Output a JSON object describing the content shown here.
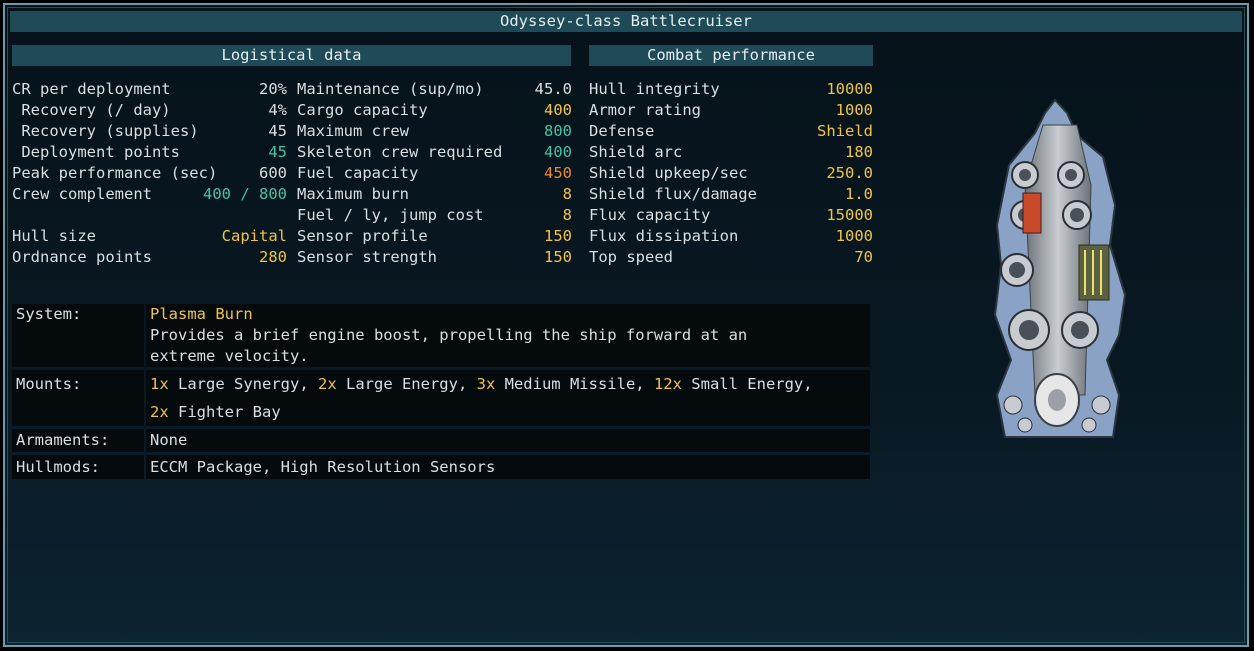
{
  "title": "Odyssey-class Battlecruiser",
  "logistical": {
    "header": "Logistical data",
    "col1": [
      {
        "label": "CR per deployment",
        "value": "20%",
        "color": "white"
      },
      {
        "label": " Recovery (/ day)",
        "value": "4%",
        "color": "white"
      },
      {
        "label": " Recovery (supplies)",
        "value": "45",
        "color": "white"
      },
      {
        "label": " Deployment points",
        "value": "45",
        "color": "teal"
      },
      {
        "label": "Peak performance (sec)",
        "value": "600",
        "color": "white"
      },
      {
        "label": "Crew complement",
        "value": "400 / 800",
        "color": "teal"
      },
      {
        "label": "",
        "value": "",
        "color": "white"
      },
      {
        "label": "Hull size",
        "value": "Capital",
        "color": "yellow"
      },
      {
        "label": "Ordnance points",
        "value": "280",
        "color": "yellow"
      }
    ],
    "col2": [
      {
        "label": "Maintenance (sup/mo)",
        "value": "45.0",
        "color": "white"
      },
      {
        "label": "Cargo capacity",
        "value": "400",
        "color": "yellow"
      },
      {
        "label": "Maximum crew",
        "value": "800",
        "color": "teal"
      },
      {
        "label": "Skeleton crew required",
        "value": "400",
        "color": "teal"
      },
      {
        "label": "Fuel capacity",
        "value": "450",
        "color": "orange"
      },
      {
        "label": "Maximum burn",
        "value": "8",
        "color": "yellow"
      },
      {
        "label": "Fuel / ly, jump cost",
        "value": "8",
        "color": "yellow"
      },
      {
        "label": "Sensor profile",
        "value": "150",
        "color": "yellow"
      },
      {
        "label": "Sensor strength",
        "value": "150",
        "color": "yellow"
      }
    ]
  },
  "combat": {
    "header": "Combat performance",
    "rows": [
      {
        "label": "Hull integrity",
        "value": "10000",
        "color": "yellow"
      },
      {
        "label": "Armor rating",
        "value": "1000",
        "color": "yellow"
      },
      {
        "label": "Defense",
        "value": "Shield",
        "color": "yellow"
      },
      {
        "label": "Shield arc",
        "value": "180",
        "color": "yellow"
      },
      {
        "label": "Shield upkeep/sec",
        "value": "250.0",
        "color": "yellow"
      },
      {
        "label": "Shield flux/damage",
        "value": "1.0",
        "color": "yellow"
      },
      {
        "label": "Flux capacity",
        "value": "15000",
        "color": "yellow"
      },
      {
        "label": "Flux dissipation",
        "value": "1000",
        "color": "yellow"
      },
      {
        "label": "Top speed",
        "value": "70",
        "color": "yellow"
      }
    ]
  },
  "details": {
    "system_label": "System:",
    "system_name": "Plasma Burn",
    "system_desc": "Provides a brief engine boost, propelling the ship forward at an extreme velocity.",
    "mounts_label": "Mounts:",
    "mounts_line1": [
      {
        "n": "1x",
        "t": " Large Synergy, "
      },
      {
        "n": "2x",
        "t": " Large Energy, "
      },
      {
        "n": "3x",
        "t": " Medium Missile, "
      },
      {
        "n": "12x",
        "t": " Small Energy,"
      }
    ],
    "mounts_line2": [
      {
        "n": "2x",
        "t": " Fighter Bay"
      }
    ],
    "armaments_label": "Armaments:",
    "armaments_value": "None",
    "hullmods_label": "Hullmods:",
    "hullmods_value": "ECCM Package, High Resolution Sensors"
  },
  "colors": {
    "white": "#d9dfe3",
    "yellow": "#f2c541",
    "teal": "#3fc6a0",
    "orange": "#f08a3a",
    "header_bg": "#1f4a57",
    "frame": "#6f9aa8"
  },
  "ship_image": "odyssey-ship-sprite"
}
